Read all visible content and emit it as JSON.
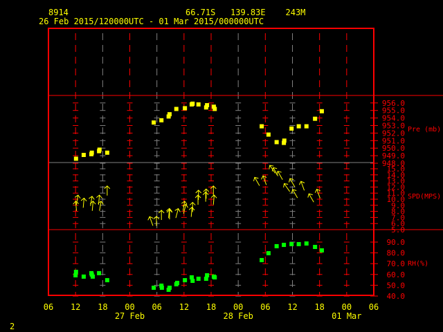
{
  "header": {
    "station": "8914",
    "location": "66.71S   139.83E    243M",
    "period": "26 Feb 2015/120000UTC - 01 Mar 2015/000000UTC"
  },
  "footer": {
    "page_number": "2"
  },
  "colors": {
    "axis": "#ff0000",
    "grid_alt": "#808080",
    "text": "#ffff00",
    "pressure": "#ffff00",
    "wind": "#ffff00",
    "rh": "#00ff00"
  },
  "chart_data": {
    "type": "scatter",
    "title": "8914 66.71S 139.83E 243M",
    "subtitle": "26 Feb 2015/120000UTC - 01 Mar 2015/000000UTC",
    "x_unit": "hours since 26 Feb 2015 00UTC",
    "xlim": [
      6,
      78
    ],
    "x_ticks": [
      6,
      12,
      18,
      24,
      30,
      36,
      42,
      48,
      54,
      60,
      66,
      72,
      78
    ],
    "x_tick_labels": [
      "06",
      "12",
      "18",
      "00",
      "06",
      "12",
      "18",
      "00",
      "06",
      "12",
      "18",
      "00",
      "06"
    ],
    "date_labels": [
      {
        "x": 24,
        "label": "27 Feb"
      },
      {
        "x": 48,
        "label": "28 Feb"
      },
      {
        "x": 72,
        "label": "01 Mar"
      }
    ],
    "panels": [
      {
        "name": "pressure",
        "ylabel": "Pre (mb)",
        "ylim": [
          948,
          956.9
        ],
        "ticks": [
          956,
          955,
          954,
          953,
          952,
          951,
          950,
          949,
          948
        ],
        "tick_labels": [
          "956.0",
          "955.0",
          "954.0",
          "953.0",
          "952.0",
          "951.0",
          "950.0",
          "949.0",
          "948.0"
        ],
        "points": [
          [
            12.1,
            948.6
          ],
          [
            13.8,
            949.1
          ],
          [
            15.5,
            949.2
          ],
          [
            15.6,
            949.4
          ],
          [
            17.2,
            949.6
          ],
          [
            17.3,
            949.8
          ],
          [
            19.0,
            949.4
          ],
          [
            29.3,
            953.4
          ],
          [
            31.0,
            953.7
          ],
          [
            32.6,
            954.2
          ],
          [
            32.8,
            954.5
          ],
          [
            34.3,
            955.2
          ],
          [
            36.2,
            955.3
          ],
          [
            37.7,
            955.8
          ],
          [
            37.9,
            955.9
          ],
          [
            39.2,
            955.8
          ],
          [
            40.9,
            955.4
          ],
          [
            41.1,
            955.7
          ],
          [
            42.6,
            955.5
          ],
          [
            42.8,
            955.2
          ],
          [
            53.2,
            952.9
          ],
          [
            54.7,
            951.8
          ],
          [
            56.5,
            950.8
          ],
          [
            58.1,
            950.7
          ],
          [
            58.2,
            951.0
          ],
          [
            59.8,
            952.6
          ],
          [
            61.4,
            952.9
          ],
          [
            63.1,
            952.9
          ],
          [
            65.0,
            953.9
          ],
          [
            66.5,
            954.9
          ]
        ]
      },
      {
        "name": "wind",
        "ylabel": "SPD(MPS)",
        "ylim": [
          5,
          16
        ],
        "ticks": [
          15,
          14,
          13,
          12,
          11,
          10,
          9,
          8,
          7,
          6,
          5
        ],
        "tick_labels": [
          "15.0",
          "14.0",
          "13.0",
          "12.0",
          "11.0",
          "10.0",
          "9.0",
          "8.0",
          "7.0",
          "6.0",
          "5.0"
        ],
        "points_speed_dir": [
          [
            12.1,
            9.0,
            355
          ],
          [
            12.4,
            10.0,
            10
          ],
          [
            13.8,
            9.5,
            5
          ],
          [
            15.5,
            9.8,
            10
          ],
          [
            15.8,
            9.0,
            5
          ],
          [
            17.2,
            10.0,
            5
          ],
          [
            17.5,
            9.0,
            10
          ],
          [
            19.0,
            11.5,
            0
          ],
          [
            28.7,
            6.5,
            340
          ],
          [
            29.9,
            6.5,
            0
          ],
          [
            31.0,
            7.5,
            0
          ],
          [
            32.7,
            7.8,
            5
          ],
          [
            32.8,
            7.6,
            0
          ],
          [
            34.5,
            7.8,
            15
          ],
          [
            36.0,
            9.0,
            10
          ],
          [
            36.2,
            8.5,
            15
          ],
          [
            37.7,
            8.0,
            5
          ],
          [
            37.9,
            8.8,
            0
          ],
          [
            39.1,
            10.0,
            0
          ],
          [
            39.2,
            10.8,
            0
          ],
          [
            40.8,
            10.5,
            0
          ],
          [
            40.9,
            11.0,
            0
          ],
          [
            42.5,
            11.5,
            0
          ],
          [
            42.6,
            10.0,
            5
          ],
          [
            52.1,
            13.0,
            330
          ],
          [
            53.8,
            13.2,
            340
          ],
          [
            55.5,
            15.0,
            325
          ],
          [
            56.2,
            14.6,
            330
          ],
          [
            57.2,
            14.0,
            330
          ],
          [
            58.7,
            12.0,
            325
          ],
          [
            59.9,
            12.8,
            330
          ],
          [
            60.5,
            11.0,
            330
          ],
          [
            62.2,
            12.3,
            340
          ],
          [
            64.1,
            10.3,
            330
          ],
          [
            65.7,
            11.0,
            340
          ]
        ]
      },
      {
        "name": "rh",
        "ylabel": "RH(%)",
        "ylim": [
          40,
          95
        ],
        "ticks": [
          90,
          80,
          70,
          60,
          50,
          40
        ],
        "tick_labels": [
          "90.0",
          "80.0",
          "70.0",
          "60.0",
          "50.0",
          "40.0"
        ],
        "points": [
          [
            12.1,
            62.4
          ],
          [
            12.0,
            59.2
          ],
          [
            13.8,
            58.0
          ],
          [
            15.5,
            61.2
          ],
          [
            15.6,
            59.9
          ],
          [
            15.8,
            58.0
          ],
          [
            17.2,
            61.2
          ],
          [
            19.0,
            54.7
          ],
          [
            29.3,
            47.7
          ],
          [
            31.0,
            49.6
          ],
          [
            31.1,
            47.7
          ],
          [
            32.6,
            45.8
          ],
          [
            32.8,
            47.7
          ],
          [
            34.3,
            50.9
          ],
          [
            34.5,
            52.2
          ],
          [
            36.2,
            54.7
          ],
          [
            37.9,
            54.1
          ],
          [
            37.7,
            57.3
          ],
          [
            39.2,
            56.0
          ],
          [
            40.9,
            56.0
          ],
          [
            41.1,
            59.2
          ],
          [
            42.6,
            58.0
          ],
          [
            42.8,
            57.3
          ],
          [
            53.2,
            73.3
          ],
          [
            54.7,
            79.7
          ],
          [
            56.5,
            86.2
          ],
          [
            58.1,
            87.4
          ],
          [
            59.8,
            88.1
          ],
          [
            61.4,
            88.1
          ],
          [
            63.1,
            88.7
          ],
          [
            65.0,
            85.5
          ],
          [
            66.5,
            82.3
          ]
        ]
      }
    ]
  }
}
